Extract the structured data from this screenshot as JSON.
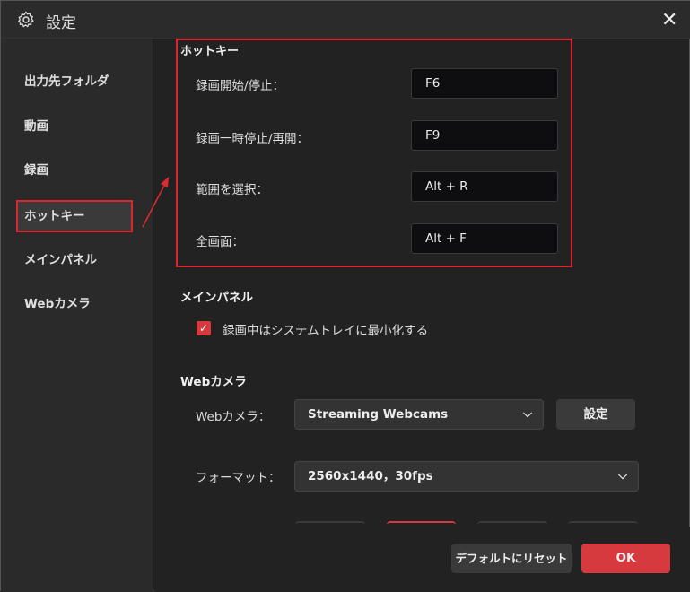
{
  "window": {
    "title": "設定",
    "close": "✕"
  },
  "sidebar": {
    "items": [
      {
        "label": "出力先フォルダ"
      },
      {
        "label": "動画"
      },
      {
        "label": "録画"
      },
      {
        "label": "ホットキー"
      },
      {
        "label": "メインパネル"
      },
      {
        "label": "Webカメラ"
      }
    ],
    "selected": "ホットキー"
  },
  "hotkeys": {
    "title": "ホットキー",
    "rows": [
      {
        "label": "録画開始/停止：",
        "value": "F6"
      },
      {
        "label": "録画一時停止/再開：",
        "value": "F9"
      },
      {
        "label": "範囲を選択：",
        "value": "Alt + R"
      },
      {
        "label": "全画面：",
        "value": "Alt + F"
      }
    ]
  },
  "main_panel": {
    "title": "メインパネル",
    "checkbox_label": "録画中はシステムトレイに最小化する",
    "checked": true
  },
  "webcam": {
    "title": "Webカメラ",
    "camera_label": "Webカメラ：",
    "camera_value": "Streaming Webcams",
    "settings_button": "設定",
    "format_label": "フォーマット：",
    "format_value": "2560x1440，30fps"
  },
  "footer": {
    "reset_button": "デフォルトにリセット",
    "ok_button": "OK"
  },
  "colors": {
    "accent": "#d63a3f",
    "highlight": "#d9282f"
  }
}
